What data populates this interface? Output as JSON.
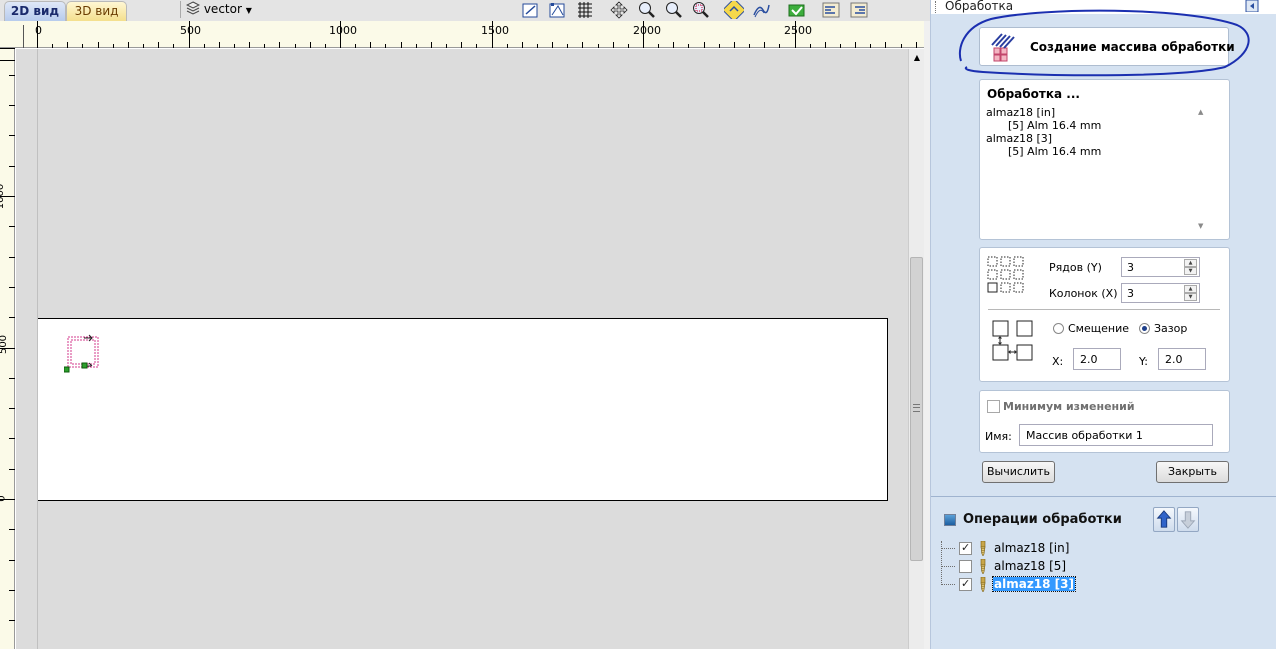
{
  "view_tabs": {
    "tab_2d": "2D вид",
    "tab_3d": "3D вид"
  },
  "toolbar": {
    "layer_name": "vector"
  },
  "ruler": {
    "top_labels": [
      "0",
      "500",
      "1000",
      "1500",
      "2000",
      "2500"
    ],
    "left_labels": [
      "1000",
      "500",
      "0"
    ]
  },
  "panel": {
    "title": "Обработка",
    "header_title": "Создание массива обработки",
    "list": {
      "title": "Обработка ...",
      "lines": [
        "almaz18 [in]",
        "[5]  Alm 16.4 mm",
        "almaz18 [3]",
        "[5]  Alm 16.4 mm"
      ]
    },
    "grid": {
      "rows_label": "Рядов (Y)",
      "rows_value": "3",
      "cols_label": "Колонок (X)",
      "cols_value": "3",
      "offset_label": "Смещение",
      "gap_label": "Зазор",
      "gap_selected": true,
      "x_label": "X:",
      "x_value": "2.0",
      "y_label": "Y:",
      "y_value": "2.0"
    },
    "minimize": {
      "label": "Минимум изменений",
      "checked": false
    },
    "name": {
      "label": "Имя:",
      "value": "Массив обработки 1"
    },
    "calc_button": "Вычислить",
    "close_button": "Закрыть"
  },
  "operations": {
    "title": "Операции обработки",
    "items": [
      {
        "label": "almaz18 [in]",
        "checked": true,
        "selected": false
      },
      {
        "label": "almaz18 [5]",
        "checked": false,
        "selected": false
      },
      {
        "label": "almaz18 [3]",
        "checked": true,
        "selected": true
      }
    ]
  },
  "colors": {
    "panel_bg": "#d5e2f1",
    "annotation_ink": "#1b2fb0",
    "selection": "#3399ff",
    "canvas_bg": "#dcdcdc"
  }
}
